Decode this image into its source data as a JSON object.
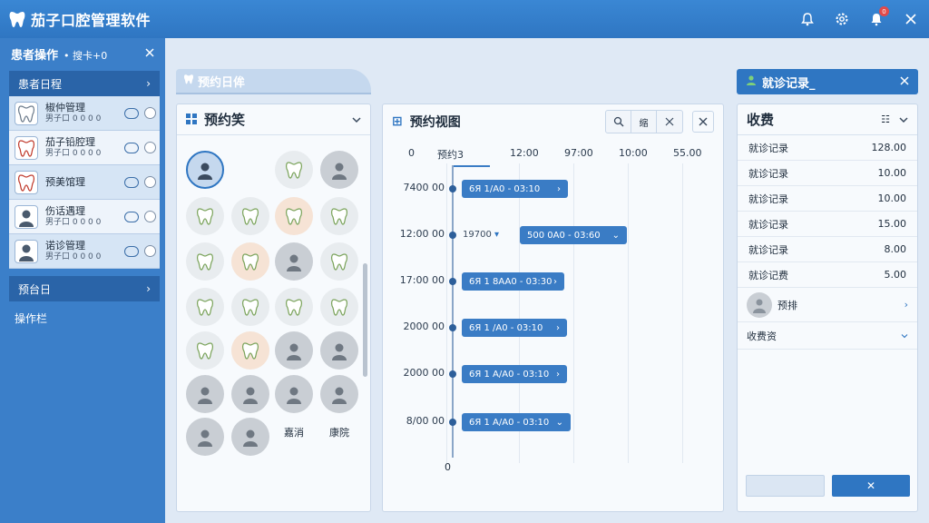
{
  "app": {
    "title": "茄子口腔管理软件"
  },
  "titlebar": {
    "notification_badge": "0"
  },
  "left_panel": {
    "header": "患者操作",
    "header_sub": "• 搜卡+0",
    "section_title": "患者日程",
    "patients": [
      {
        "name": "椒仲管理",
        "meta": "男子口 0 0 0 0",
        "avatar": "tooth-icon"
      },
      {
        "name": "茄子铅腔理",
        "meta": "男子口 0 0 0 0",
        "avatar": "tooth-red-icon"
      },
      {
        "name": "预美馆理",
        "meta": "",
        "avatar": "tooth-red-icon"
      },
      {
        "name": "伤话遇理",
        "meta": "男子口 0 0 0 0",
        "avatar": "person-icon"
      },
      {
        "name": "诺诊管理",
        "meta": "男子口 0 0 0 0",
        "avatar": "person-icon"
      }
    ],
    "section2_title": "预台日",
    "ops_label": "操作栏"
  },
  "appointment": {
    "tab_label": "预约日侔",
    "panel_title": "预约笑",
    "grid_labels": [
      "嘉消",
      "康院"
    ]
  },
  "calendar": {
    "title": "预约视图",
    "tools": [
      "search-icon",
      "缩",
      "expand-icon"
    ],
    "columns": [
      "0",
      "预约3",
      "12:00",
      "97:00",
      "10:00",
      "55.00"
    ],
    "rows": [
      "7400 00",
      "12:00 00",
      "17:00 00",
      "2000 00",
      "2000 00",
      "8/00 00"
    ],
    "footer_label": "0",
    "row2_note": "19700",
    "events": [
      {
        "label": "6Я 1/A0 - 03:10"
      },
      {
        "label": "500 0A0 - 03:60"
      },
      {
        "label": "6Я 1 8AA0 - 03:30"
      },
      {
        "label": "6Я 1 /A0 - 03:10"
      },
      {
        "label": "6Я 1 A/A0 - 03:10"
      },
      {
        "label": "6Я 1 A/A0 - 03:10"
      }
    ]
  },
  "visit": {
    "tab_label": "就诊记录_",
    "panel_title": "收费",
    "fees": [
      {
        "label": "就诊记录",
        "value": "128.00"
      },
      {
        "label": "就诊记录",
        "value": "10.00"
      },
      {
        "label": "就诊记录",
        "value": "10.00"
      },
      {
        "label": "就诊记录",
        "value": "15.00"
      },
      {
        "label": "就诊记录",
        "value": "8.00"
      },
      {
        "label": "就诊记费",
        "value": "5.00"
      }
    ],
    "doctor_label": "预排",
    "fee_select_label": "收费资",
    "confirm_button": "✕"
  },
  "colors": {
    "accent": "#2f76c2",
    "panel_bg": "#f7fafd",
    "sidebar": "#3b7fc9"
  }
}
